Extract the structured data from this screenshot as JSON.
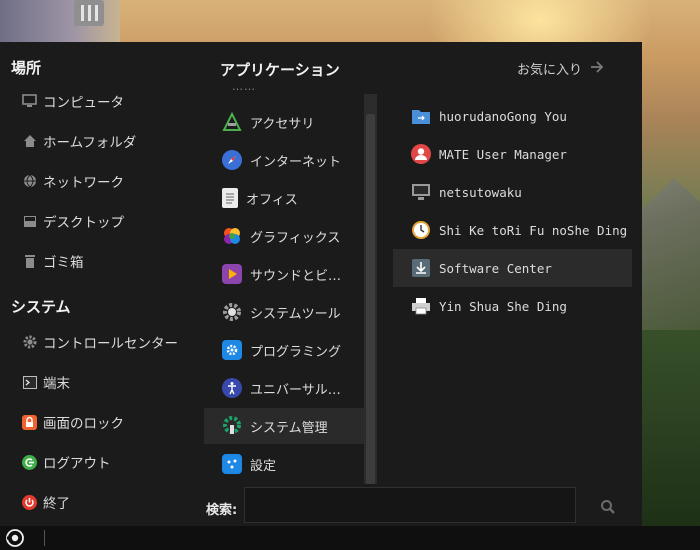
{
  "places": {
    "title": "場所",
    "items": [
      {
        "label": "コンピュータ",
        "icon": "monitor-icon"
      },
      {
        "label": "ホームフォルダ",
        "icon": "home-icon"
      },
      {
        "label": "ネットワーク",
        "icon": "network-icon"
      },
      {
        "label": "デスクトップ",
        "icon": "desktop-icon"
      },
      {
        "label": "ゴミ箱",
        "icon": "trash-icon"
      }
    ]
  },
  "system": {
    "title": "システム",
    "items": [
      {
        "label": "コントロールセンター",
        "icon": "gear-icon"
      },
      {
        "label": "端末",
        "icon": "terminal-icon"
      },
      {
        "label": "画面のロック",
        "icon": "lock-icon"
      },
      {
        "label": "ログアウト",
        "icon": "logout-icon"
      },
      {
        "label": "終了",
        "icon": "power-icon"
      }
    ]
  },
  "applications": {
    "title": "アプリケーション",
    "favorites_label": "お気に入り",
    "categories": [
      {
        "label": "アクセサリ",
        "icon": "accessories-icon",
        "color": "#2f2f2f"
      },
      {
        "label": "インターネット",
        "icon": "compass-icon",
        "color": "#3a6fd8"
      },
      {
        "label": "オフィス",
        "icon": "document-icon",
        "color": "#e8e8e8"
      },
      {
        "label": "グラフィックス",
        "icon": "graphics-icon",
        "color": "#e94e3c"
      },
      {
        "label": "サウンドとビ…",
        "icon": "multimedia-icon",
        "color": "#8e44ad"
      },
      {
        "label": "システムツール",
        "icon": "system-tools-icon",
        "color": "#555555"
      },
      {
        "label": "プログラミング",
        "icon": "programming-icon",
        "color": "#1e88e5"
      },
      {
        "label": "ユニバーサル…",
        "icon": "accessibility-icon",
        "color": "#3949ab"
      },
      {
        "label": "システム管理",
        "icon": "administration-icon",
        "color": "#1aa36b",
        "selected": true
      },
      {
        "label": "設定",
        "icon": "settings-icon",
        "color": "#1e88e5"
      }
    ],
    "apps": [
      {
        "label": "huorudanoGong You",
        "icon": "folder-share-icon",
        "color": "#4a90d9"
      },
      {
        "label": "MATE User Manager",
        "icon": "user-icon",
        "color": "#e04848"
      },
      {
        "label": "netsutowaku",
        "icon": "network-monitor-icon",
        "color": "#9a9a9a"
      },
      {
        "label": "Shi Ke toRi Fu noShe Ding",
        "icon": "clock-icon",
        "color": "#e8a33c"
      },
      {
        "label": "Software Center",
        "icon": "download-icon",
        "color": "#5a6b78",
        "selected": true
      },
      {
        "label": "Yin Shua She Ding",
        "icon": "printer-icon",
        "color": "#cfcfcf"
      }
    ]
  },
  "search": {
    "label": "検索:",
    "value": "",
    "placeholder": ""
  }
}
